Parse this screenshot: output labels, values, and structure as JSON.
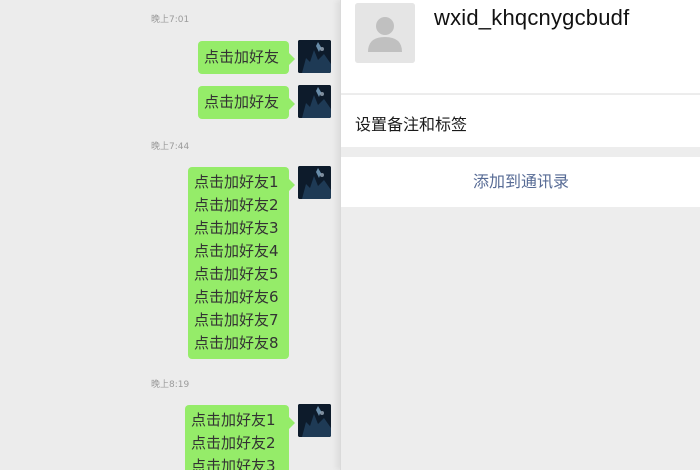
{
  "chat": {
    "timestamps": [
      "晚上7:01",
      "晚上7:44",
      "晚上8:19"
    ],
    "bubble1": "点击加好友",
    "bubble2": "点击加好友",
    "bubble3": [
      "点击加好友1",
      "点击加好友2",
      "点击加好友3",
      "点击加好友4",
      "点击加好友5",
      "点击加好友6",
      "点击加好友7",
      "点击加好友8"
    ],
    "bubble4": [
      "点击加好友1",
      "点击加好友2",
      "点击加好友3"
    ]
  },
  "profile": {
    "wxid": "wxid_khqcnygcbudf",
    "avatar_icon": "default-user-icon"
  },
  "remark": {
    "label": "设置备注和标签"
  },
  "actions": {
    "add_contact": "添加到通讯录",
    "link_color": "#576b95"
  },
  "colors": {
    "bubble": "#95ec69",
    "background": "#ededed"
  }
}
